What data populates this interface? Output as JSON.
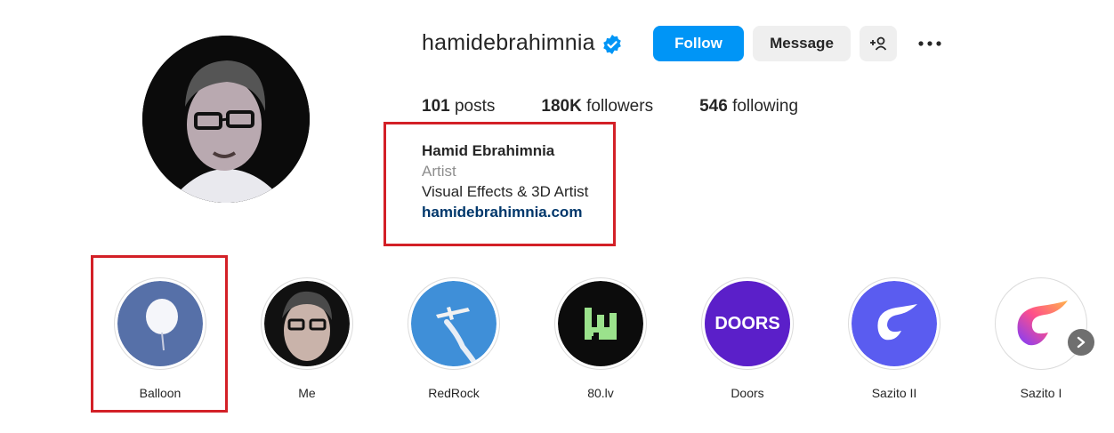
{
  "profile": {
    "username": "hamidebrahimnia",
    "verified": true,
    "follow_label": "Follow",
    "message_label": "Message",
    "add_user_label": "+&",
    "more_label": "•••",
    "stats": {
      "posts_count": "101",
      "posts_label": "posts",
      "followers_count": "180K",
      "followers_label": "followers",
      "following_count": "546",
      "following_label": "following"
    },
    "bio": {
      "name": "Hamid Ebrahimnia",
      "category": "Artist",
      "description": "Visual Effects & 3D Artist",
      "link": "hamidebrahimnia.com"
    }
  },
  "highlights": [
    {
      "label": "Balloon"
    },
    {
      "label": "Me"
    },
    {
      "label": "RedRock"
    },
    {
      "label": "80.lv"
    },
    {
      "label": "Doors",
      "logo_text": "DOORS"
    },
    {
      "label": "Sazito II"
    },
    {
      "label": "Sazito I"
    }
  ],
  "colors": {
    "accent": "#0095f6",
    "annotation_red": "#d32027",
    "link": "#00376b",
    "muted": "#8e8e8e"
  },
  "icons": {
    "verified": "verified-badge-icon",
    "add_user": "add-user-icon",
    "more": "more-horizontal-icon",
    "next": "chevron-right-icon"
  }
}
